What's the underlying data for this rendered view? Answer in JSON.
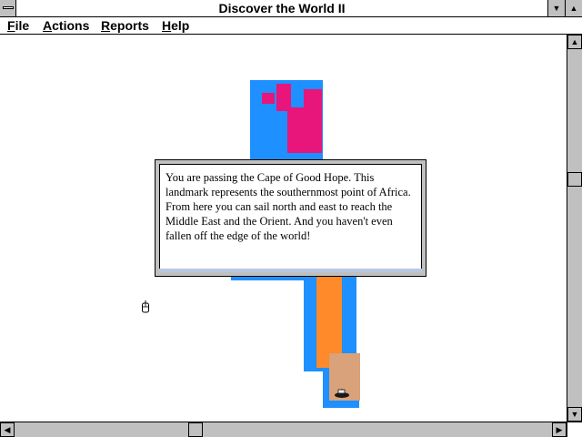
{
  "window": {
    "title": "Discover the World II",
    "minimize_glyph": "▼",
    "maximize_glyph": "▲"
  },
  "menu": {
    "items": [
      {
        "accel": "F",
        "rest": "ile"
      },
      {
        "accel": "A",
        "rest": "ctions"
      },
      {
        "accel": "R",
        "rest": "eports"
      },
      {
        "accel": "H",
        "rest": "elp"
      }
    ]
  },
  "dialog": {
    "message": "You are passing the Cape of Good Hope.  This landmark represents the southernmost point of Africa.  From here you can sail north and east to reach the Middle East and the Orient.  And you haven't even fallen off the edge of the world!"
  },
  "scrollbars": {
    "up_glyph": "▲",
    "down_glyph": "▼",
    "left_glyph": "◀",
    "right_glyph": "▶"
  },
  "colors": {
    "sea": "#1e90ff",
    "europe_land": "#e8157a",
    "africa_land": "#ff8a2a",
    "south_africa_land": "#d9a27a"
  },
  "icons": [
    "system-menu-icon",
    "mouse-icon",
    "ship-icon"
  ]
}
